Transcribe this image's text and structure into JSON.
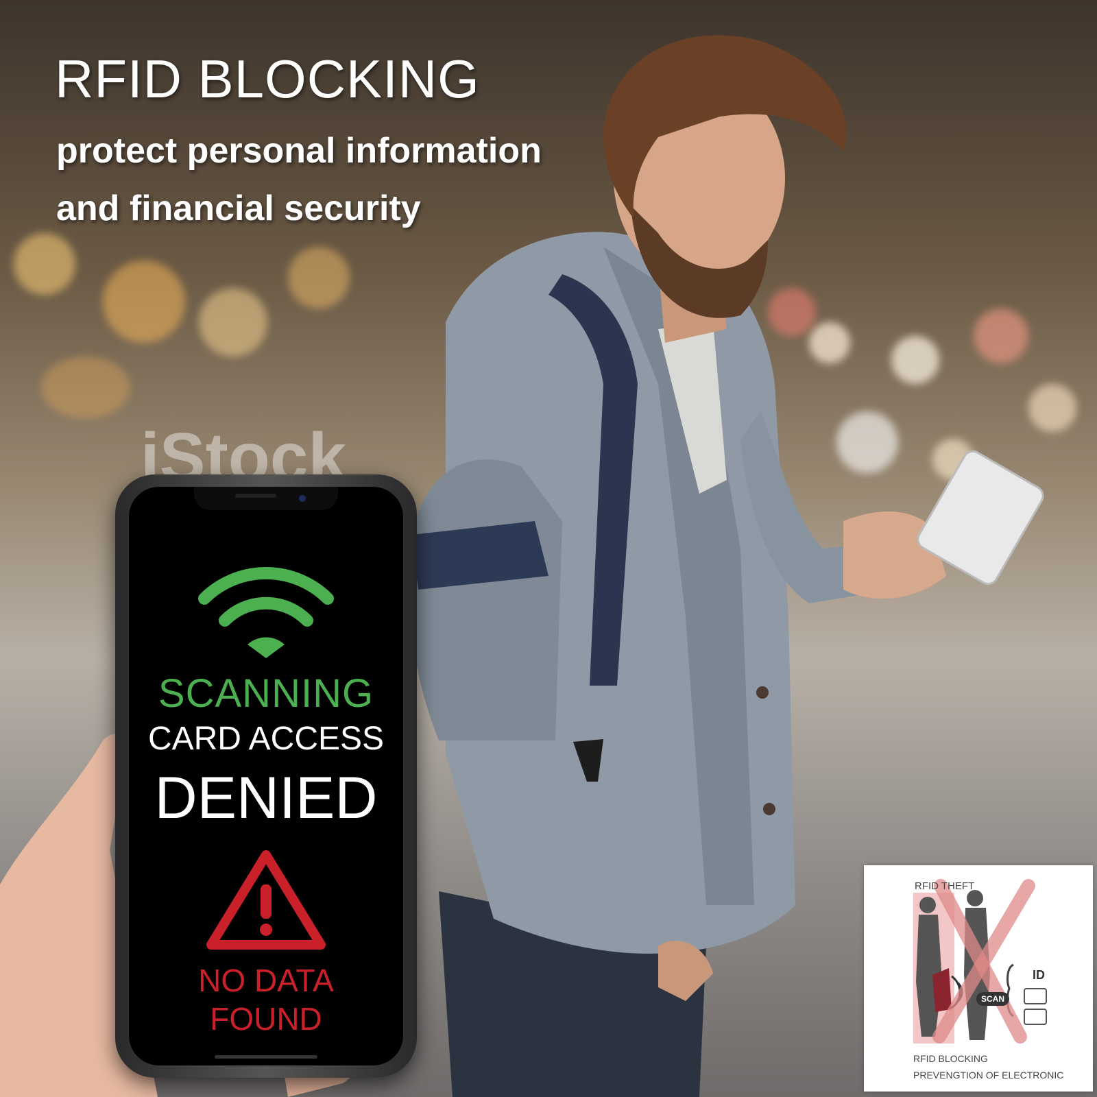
{
  "banner": {
    "headline": "RFID BLOCKING",
    "subline_1": "protect personal information",
    "subline_2": "and financial security"
  },
  "watermark": {
    "text": "iStock"
  },
  "phone_screen": {
    "wifi_icon": "wifi-icon",
    "scanning": "SCANNING",
    "card_access": "CARD ACCESS",
    "denied": "DENIED",
    "warning_icon": "warning-triangle-icon",
    "no_data_1": "NO DATA",
    "no_data_2": "FOUND"
  },
  "info_box": {
    "rfid_theft": "RFID THEFT",
    "id_label": "ID",
    "scan_label": "SCAN",
    "footer_1": "RFID BLOCKING",
    "footer_2": "PREVENGTION OF ELECTRONIC"
  },
  "colors": {
    "scan_green": "#4caf50",
    "alert_red": "#c9202a",
    "text_white": "#ffffff",
    "screen_black": "#000000",
    "cross_red": "#e08a8a"
  }
}
